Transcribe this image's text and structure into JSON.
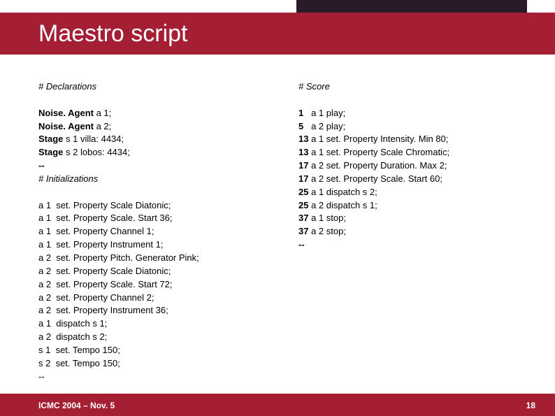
{
  "title": "Maestro script",
  "left": {
    "heading": "# Declarations",
    "decl": [
      {
        "b": "Noise. Agent ",
        "r": "a 1;"
      },
      {
        "b": "Noise. Agent ",
        "r": "a 2;"
      },
      {
        "b": "Stage ",
        "r": "s 1 villa: 4434;"
      },
      {
        "b": "Stage ",
        "r": "s 2 lobos: 4434;"
      },
      {
        "b": "--",
        "r": ""
      }
    ],
    "init_heading": "# Initializations",
    "body": [
      "a 1  set. Property Scale Diatonic;",
      "a 1  set. Property Scale. Start 36;",
      "a 1  set. Property Channel 1;",
      "a 1  set. Property Instrument 1;",
      "a 2  set. Property Pitch. Generator Pink;",
      "a 2  set. Property Scale Diatonic;",
      "a 2  set. Property Scale. Start 72;",
      "a 2  set. Property Channel 2;",
      "a 2  set. Property Instrument 36;",
      "a 1  dispatch s 1;",
      "a 2  dispatch s 2;",
      "s 1  set. Tempo 150;",
      "s 2  set. Tempo 150;",
      "--"
    ]
  },
  "right": {
    "heading": "# Score",
    "body": [
      {
        "b": "1",
        "r": "   a 1 play;"
      },
      {
        "b": "5",
        "r": "   a 2 play;"
      },
      {
        "b": "13",
        "r": " a 1 set. Property Intensity. Min 80;"
      },
      {
        "b": "13",
        "r": " a 1 set. Property Scale Chromatic;"
      },
      {
        "b": "17",
        "r": " a 2 set. Property Duration. Max 2;"
      },
      {
        "b": "17",
        "r": " a 2 set. Property Scale. Start 60;"
      },
      {
        "b": "25",
        "r": " a 1 dispatch s 2;"
      },
      {
        "b": "25",
        "r": " a 2 dispatch s 1;"
      },
      {
        "b": "37",
        "r": " a 1 stop;"
      },
      {
        "b": "37",
        "r": " a 2 stop;"
      },
      {
        "b": "--",
        "r": ""
      }
    ]
  },
  "footer": {
    "left": "ICMC 2004 – Nov. 5",
    "page": "18"
  }
}
